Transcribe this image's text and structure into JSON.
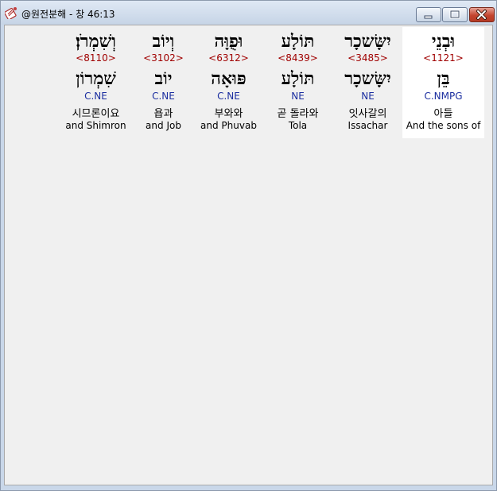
{
  "window": {
    "title": "@원전분해 - 창 46:13"
  },
  "icons": {
    "app": "app-icon",
    "minimize": "minimize-icon",
    "maximize": "maximize-icon",
    "close": "close-icon"
  },
  "words": [
    {
      "hebrew": "וּבְנֵי",
      "strong": "<1121>",
      "lemma": "בֵּן",
      "morph": "C.NMPG",
      "korean": "아들",
      "english": "And the sons of",
      "selected": true
    },
    {
      "hebrew": "יִשָּׂשכָר",
      "strong": "<3485>",
      "lemma": "יִשָּׂשכָר",
      "morph": "NE",
      "korean": "잇사갈의",
      "english": "Issachar",
      "selected": false
    },
    {
      "hebrew": "תּוֹלָע",
      "strong": "<8439>",
      "lemma": "תּוֹלָע",
      "morph": "NE",
      "korean": "곧 돌라와",
      "english": "Tola",
      "selected": false
    },
    {
      "hebrew": "וּפֻוָּה",
      "strong": "<6312>",
      "lemma": "פּוּאָה",
      "morph": "C.NE",
      "korean": "부와와",
      "english": "and Phuvab",
      "selected": false
    },
    {
      "hebrew": "וְיוֹב",
      "strong": "<3102>",
      "lemma": "יוֹב",
      "morph": "C.NE",
      "korean": "욥과",
      "english": "and Job",
      "selected": false
    },
    {
      "hebrew": "וְשִׁמְרֹן׃",
      "strong": "<8110>",
      "lemma": "שִׁמְרוֹן",
      "morph": "C.NE",
      "korean": "시므론이요",
      "english": "and Shimron",
      "selected": false
    }
  ]
}
